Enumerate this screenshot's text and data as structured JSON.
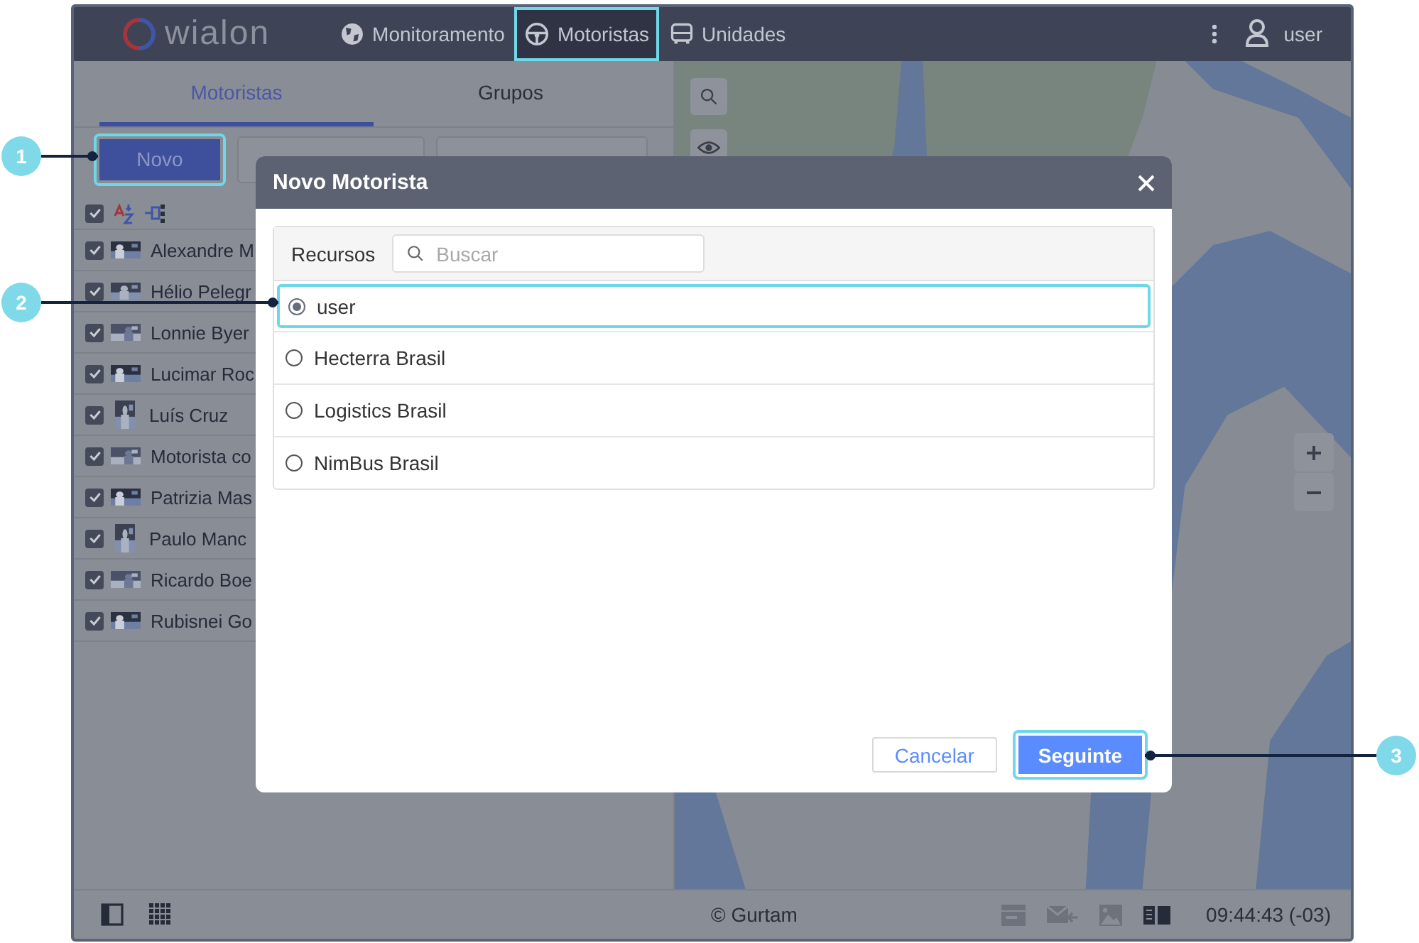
{
  "header": {
    "logo": "wialon",
    "nav": [
      {
        "label": "Monitoramento",
        "selected": false,
        "highlighted": false
      },
      {
        "label": "Motoristas",
        "selected": true,
        "highlighted": true
      },
      {
        "label": "Unidades",
        "selected": false,
        "highlighted": false
      }
    ],
    "user": "user"
  },
  "sidebar": {
    "tabs": [
      {
        "label": "Motoristas",
        "selected": true
      },
      {
        "label": "Grupos",
        "selected": false
      }
    ],
    "new_button": {
      "label": "Novo",
      "highlighted": true
    },
    "header_checked": true,
    "drivers": [
      {
        "name": "Alexandre M",
        "checked": true
      },
      {
        "name": "Hélio Pelegr",
        "checked": true
      },
      {
        "name": "Lonnie Byer",
        "checked": true
      },
      {
        "name": "Lucimar Roc",
        "checked": true
      },
      {
        "name": "Luís Cruz",
        "checked": true
      },
      {
        "name": "Motorista co",
        "checked": true
      },
      {
        "name": "Patrizia Mas",
        "checked": true
      },
      {
        "name": "Paulo Manc",
        "checked": true
      },
      {
        "name": "Ricardo Boe",
        "checked": true
      },
      {
        "name": "Rubisnei Go",
        "checked": true
      }
    ]
  },
  "status_bar": {
    "copyright": "© Gurtam",
    "time": "09:44:43 (-03)"
  },
  "dialog": {
    "title": "Novo Motorista",
    "resources_label": "Recursos",
    "search": {
      "placeholder": "Buscar"
    },
    "resources": [
      {
        "name": "user",
        "selected": true,
        "highlighted": true
      },
      {
        "name": "Hecterra Brasil",
        "selected": false,
        "highlighted": false
      },
      {
        "name": "Logistics Brasil",
        "selected": false,
        "highlighted": false
      },
      {
        "name": "NimBus Brasil",
        "selected": false,
        "highlighted": false
      }
    ],
    "buttons": [
      {
        "label": "Cancelar",
        "kind": "secondary",
        "highlighted": false
      },
      {
        "label": "Seguinte",
        "kind": "primary",
        "highlighted": true
      }
    ]
  },
  "callouts": [
    {
      "number": "1"
    },
    {
      "number": "2"
    },
    {
      "number": "3"
    }
  ]
}
